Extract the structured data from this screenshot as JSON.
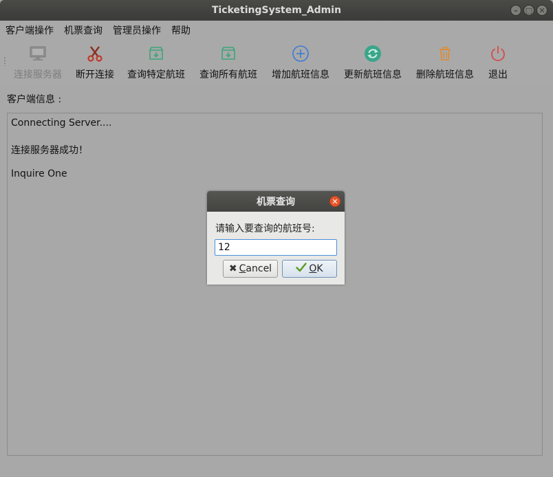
{
  "window": {
    "title": "TicketingSystem_Admin"
  },
  "menubar": {
    "items": [
      "客户端操作",
      "机票查询",
      "管理员操作",
      "帮助"
    ]
  },
  "toolbar": {
    "connect": "连接服务器",
    "disconnect": "断开连接",
    "query_specific": "查询特定航班",
    "query_all": "查询所有航班",
    "add": "增加航班信息",
    "update": "更新航班信息",
    "delete": "删除航班信息",
    "exit": "退出"
  },
  "client_info": {
    "label": "客户端信息 :",
    "lines": [
      "Connecting Server....",
      "连接服务器成功！",
      "Inquire One"
    ]
  },
  "dialog": {
    "title": "机票查询",
    "prompt": "请输入要查询的航班号:",
    "input_value": "12",
    "cancel_mnemonic": "C",
    "cancel_rest": "ancel",
    "ok_mnemonic": "O",
    "ok_rest": "K"
  },
  "colors": {
    "background": "#a8a8a8",
    "titlebar": "#3b3b39",
    "dialog_close": "#e8562a",
    "icon_green": "#3aa57a",
    "icon_blue": "#3a7bd5",
    "icon_orange": "#e08b2a",
    "icon_red": "#d64a4a"
  },
  "icons": {
    "connect": "computer-icon",
    "disconnect": "scissors-icon",
    "query_specific": "download-box-icon",
    "query_all": "download-box-icon",
    "add": "plus-circle-icon",
    "update": "refresh-icon",
    "delete": "trash-icon",
    "exit": "power-icon"
  }
}
